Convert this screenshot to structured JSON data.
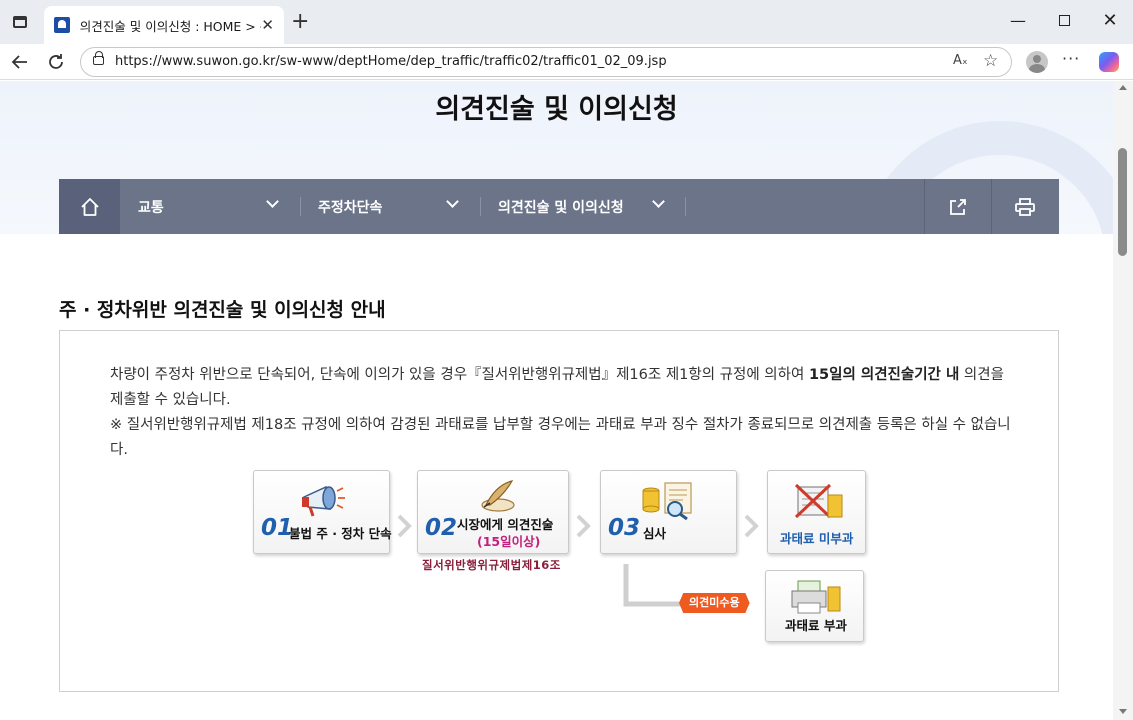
{
  "browser": {
    "tab_title": "의견진술 및 이의신청 : HOME > 분야별정보 > 교통",
    "url": "https://www.suwon.go.kr/sw-www/deptHome/dep_traffic/traffic02/traffic01_02_09.jsp",
    "read_aloud_label": "Aₓ",
    "icons": [
      "tab-actions-icon",
      "close-icon",
      "plus-icon",
      "minimize-icon",
      "maximize-icon",
      "back-arrow-icon",
      "reload-icon",
      "lock-icon",
      "read-aloud-icon",
      "star-icon",
      "profile-icon",
      "more-icon",
      "copilot-icon"
    ]
  },
  "page": {
    "title": "의견진술 및 이의신청"
  },
  "navbar": {
    "home_icon": "home-icon",
    "menus": [
      {
        "label": "교통"
      },
      {
        "label": "주정차단속"
      },
      {
        "label": "의견진술 및 이의신청"
      }
    ],
    "share_icon": "share-icon",
    "print_icon": "print-icon"
  },
  "section": {
    "title": "주 · 정차위반 의견진술 및 이의신청 안내",
    "para1_before": "차량이 주정차 위반으로 단속되어, 단속에 이의가 있을 경우『질서위반행위규제법』제16조 제1항의 규정에 의하여 ",
    "para1_bold": "15일의 의견진술기간 내",
    "para1_after": " 의견을 제출할 수 있습니다.",
    "para2": "※ 질서위반행위규제법 제18조 규정에 의하여 감경된 과태료를 납부할 경우에는 과태료 부과 징수 절차가 종료되므로 의견제출 등록은 하실 수 없습니다."
  },
  "flow": {
    "steps": [
      {
        "num": "01",
        "label": "불법 주 · 정차 단속",
        "icon": "megaphone-icon"
      },
      {
        "num": "02",
        "label": "시장에게 의견진술",
        "sub": "(15일이상)",
        "icon": "quill-icon"
      },
      {
        "num": "03",
        "label": "심사",
        "icon": "review-coins-icon"
      }
    ],
    "law_caption": "질서위반행위규제법제16조",
    "accepted_result": "과태료 미부과",
    "rejected_tag": "의견미수용",
    "rejected_result": "과태료 부과"
  }
}
